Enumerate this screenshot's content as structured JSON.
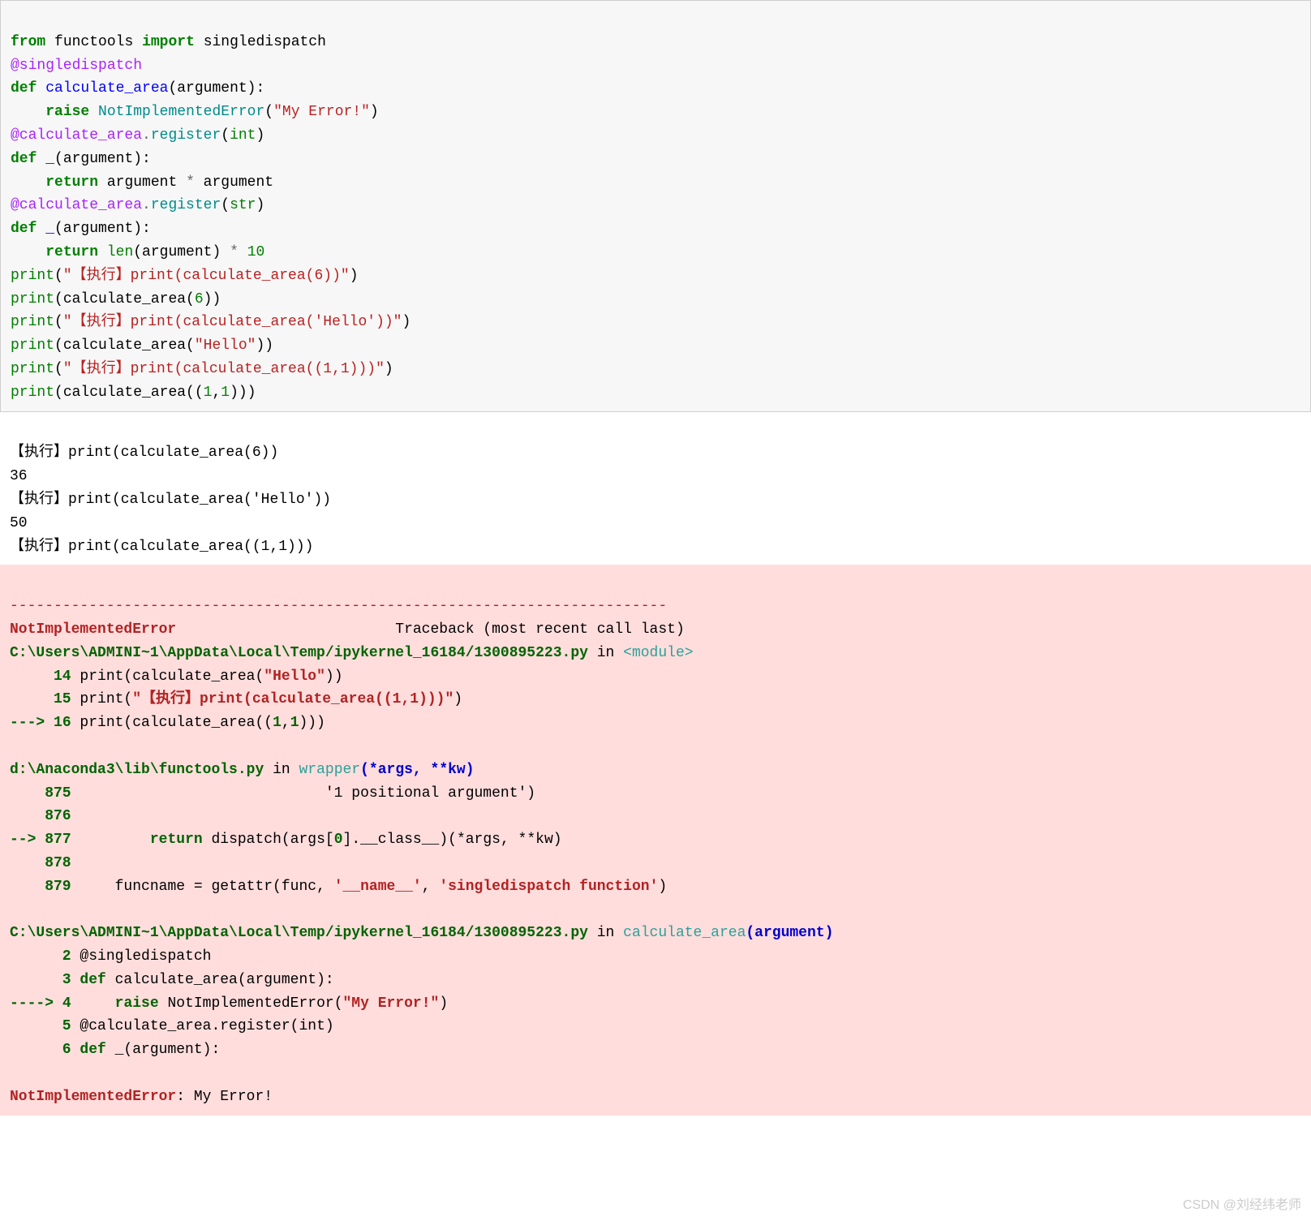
{
  "code": {
    "l1": {
      "from": "from",
      "mod": "functools",
      "import": "import",
      "name": "singledispatch"
    },
    "l2": {
      "at": "@singledispatch"
    },
    "l3": {
      "def": "def",
      "fn": "calculate_area",
      "args": "(argument):"
    },
    "l4": {
      "raise": "raise",
      "err": "NotImplementedError",
      "open": "(",
      "str": "\"My Error!\"",
      "close": ")"
    },
    "l5": {
      "at": "@calculate_area",
      "dot": ".",
      "reg": "register",
      "open": "(",
      "type": "int",
      "close": ")"
    },
    "l6": {
      "def": "def",
      "fn": "_",
      "args": "(argument):"
    },
    "l7": {
      "ret": "return",
      "expr1": "argument ",
      "op": "*",
      "expr2": " argument"
    },
    "l8": {
      "at": "@calculate_area",
      "dot": ".",
      "reg": "register",
      "open": "(",
      "type": "str",
      "close": ")"
    },
    "l9": {
      "def": "def",
      "fn": "_",
      "args": "(argument):"
    },
    "l10": {
      "ret": "return",
      "len": "len",
      "args": "(argument) ",
      "op": "*",
      "num": " 10"
    },
    "l11": {
      "print": "print",
      "open": "(",
      "str": "\"【执行】print(calculate_area(6))\"",
      "close": ")"
    },
    "l12": {
      "print": "print",
      "open": "(calculate_area(",
      "num": "6",
      "close": "))"
    },
    "l13": {
      "print": "print",
      "open": "(",
      "str": "\"【执行】print(calculate_area('Hello'))\"",
      "close": ")"
    },
    "l14": {
      "print": "print",
      "open": "(calculate_area(",
      "str": "\"Hello\"",
      "close": "))"
    },
    "l15": {
      "print": "print",
      "open": "(",
      "str": "\"【执行】print(calculate_area((1,1)))\"",
      "close": ")"
    },
    "l16": {
      "print": "print",
      "open": "(calculate_area((",
      "n1": "1",
      "comma": ",",
      "n2": "1",
      "close": ")))"
    }
  },
  "output": {
    "l1": "【执行】print(calculate_area(6))",
    "l2": "36",
    "l3": "【执行】print(calculate_area('Hello'))",
    "l4": "50",
    "l5": "【执行】print(calculate_area((1,1)))"
  },
  "error": {
    "dashes": "---------------------------------------------------------------------------",
    "name": "NotImplementedError",
    "tb_label": "Traceback (most recent call last)",
    "frame1": {
      "path": "C:\\Users\\ADMINI~1\\AppData\\Local\\Temp/ipykernel_16184/1300895223.py",
      "in": " in ",
      "func": "<module>",
      "l14_no": "     14 ",
      "l14_a": "print(calculate_area(",
      "l14_str": "\"Hello\"",
      "l14_b": "))",
      "l15_no": "     15 ",
      "l15_a": "print(",
      "l15_str": "\"【执行】print(calculate_area((1,1)))\"",
      "l15_b": ")",
      "l16_arrow": "---> ",
      "l16_no": "16 ",
      "l16_a": "print(calculate_area((",
      "l16_n1": "1",
      "l16_c": ",",
      "l16_n2": "1",
      "l16_b": ")))"
    },
    "frame2": {
      "path": "d:\\Anaconda3\\lib\\functools.py",
      "in": " in ",
      "func": "wrapper",
      "sig_a": "(*args, **kw)",
      "l875_no": "    875 ",
      "l875": "                            '1 positional argument')",
      "l876_no": "    876 ",
      "l877_arrow": "--> ",
      "l877_no": "877 ",
      "l877_a": "        ",
      "l877_ret": "return",
      "l877_b": " dispatch(args[",
      "l877_idx": "0",
      "l877_c": "].__class__)(*args, **kw)",
      "l878_no": "    878 ",
      "l879_no": "    879 ",
      "l879_a": "    funcname = getattr(func, ",
      "l879_s1": "'__name__'",
      "l879_b": ", ",
      "l879_s2": "'singledispatch function'",
      "l879_c": ")"
    },
    "frame3": {
      "path": "C:\\Users\\ADMINI~1\\AppData\\Local\\Temp/ipykernel_16184/1300895223.py",
      "in": " in ",
      "func": "calculate_area",
      "sig": "(argument)",
      "l2_no": "      2 ",
      "l2": "@singledispatch",
      "l3_no": "      3 ",
      "l3_def": "def",
      "l3_b": " calculate_area(argument):",
      "l4_arrow": "----> ",
      "l4_no": "4 ",
      "l4_a": "    ",
      "l4_raise": "raise",
      "l4_b": " NotImplementedError(",
      "l4_str": "\"My Error!\"",
      "l4_c": ")",
      "l5_no": "      5 ",
      "l5_a": "@calculate_area.register(",
      "l5_type": "int",
      "l5_b": ")",
      "l6_no": "      6 ",
      "l6_def": "def",
      "l6_b": " _(argument):"
    },
    "final_name": "NotImplementedError",
    "final_msg": ": My Error!"
  },
  "watermark": "CSDN @刘经纬老师"
}
